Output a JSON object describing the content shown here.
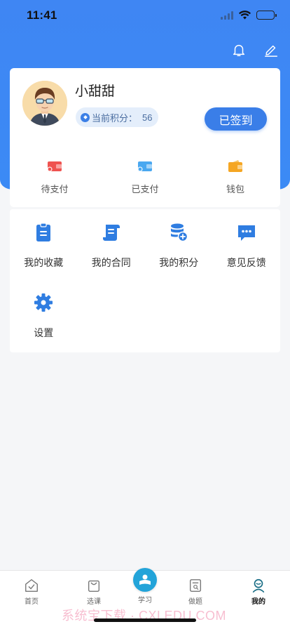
{
  "status_bar": {
    "time": "11:41"
  },
  "header": {
    "bell_icon": "bell-icon",
    "edit_icon": "edit-icon"
  },
  "profile": {
    "user_name": "小甜甜",
    "points_label": "当前积分：",
    "points_value": "56",
    "signin_label": "已签到"
  },
  "payments": [
    {
      "label": "待支付",
      "icon": "pending-payment-icon",
      "color": "#ef5350"
    },
    {
      "label": "已支付",
      "icon": "paid-icon",
      "color": "#4aa8f0"
    },
    {
      "label": "钱包",
      "icon": "wallet-icon",
      "color": "#f5a623"
    }
  ],
  "menu": [
    {
      "label": "我的收藏",
      "icon": "clipboard-icon"
    },
    {
      "label": "我的合同",
      "icon": "contract-scroll-icon"
    },
    {
      "label": "我的积分",
      "icon": "points-database-icon"
    },
    {
      "label": "意见反馈",
      "icon": "feedback-chat-icon"
    },
    {
      "label": "设置",
      "icon": "gear-icon"
    }
  ],
  "tabbar": [
    {
      "label": "首页",
      "icon": "home-icon"
    },
    {
      "label": "选课",
      "icon": "shopping-bag-icon"
    },
    {
      "label": "学习",
      "icon": "study-icon"
    },
    {
      "label": "做题",
      "icon": "exercise-icon"
    },
    {
      "label": "我的",
      "icon": "profile-icon",
      "active": true
    }
  ],
  "watermark": "系统宝下载 · CXLEDU.COM",
  "colors": {
    "primary": "#3a7ee8",
    "accent_teal": "#23a4d9",
    "background": "#f5f6f8"
  }
}
